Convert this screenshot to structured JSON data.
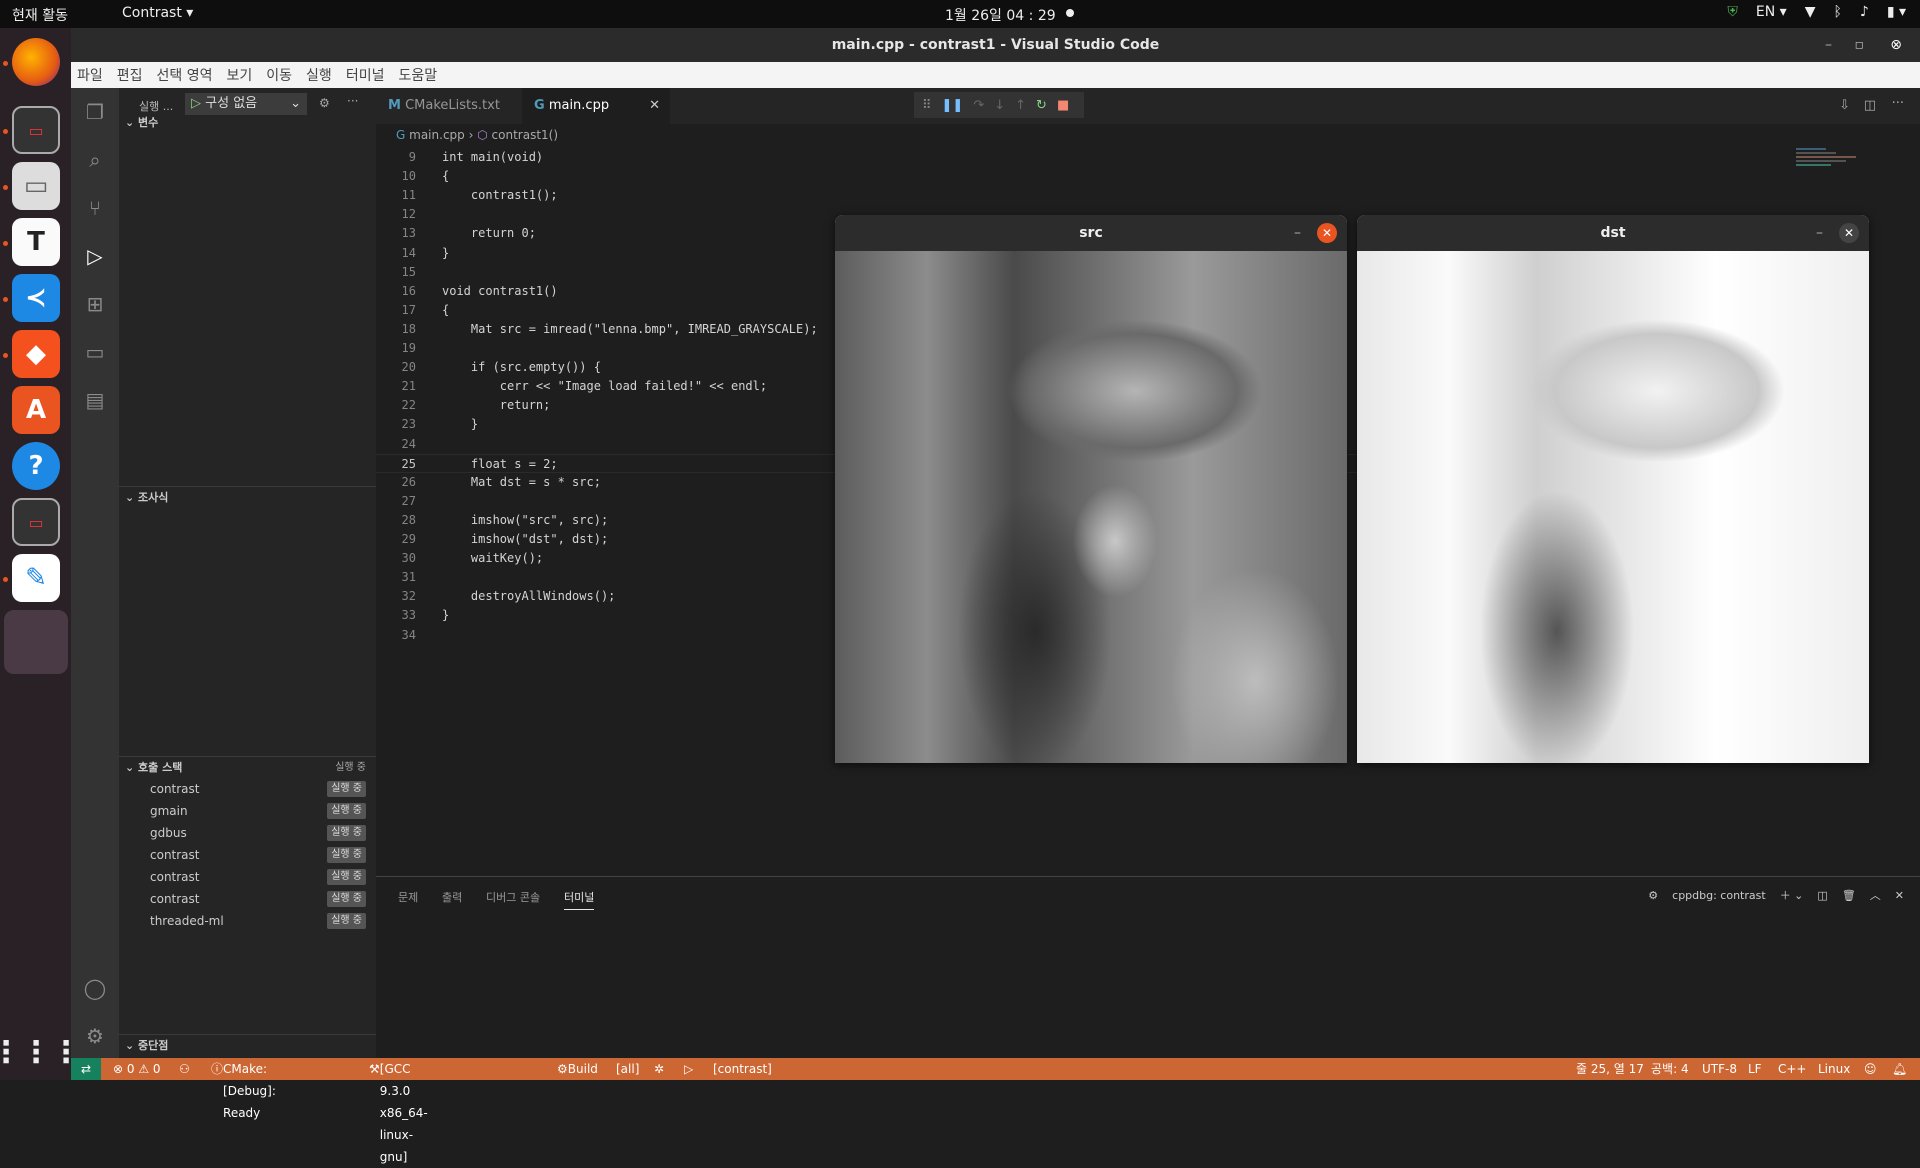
{
  "topbar": {
    "activities": "현재 활동",
    "app_name": "Contrast ▾",
    "clock": "1월 26일  04 : 29",
    "lang": "EN ▾"
  },
  "window": {
    "title": "main.cpp - contrast1 - Visual Studio Code"
  },
  "menu": [
    "파일",
    "편집",
    "선택 영역",
    "보기",
    "이동",
    "실행",
    "터미널",
    "도움말"
  ],
  "run_view": {
    "run_label": "실행 ...",
    "config": "구성 없음",
    "variables_header": "변수",
    "watch_header": "조사식",
    "callstack_header": "호출 스택",
    "callstack_status": "실행 중",
    "callstack": [
      {
        "name": "contrast",
        "state": "실행 중"
      },
      {
        "name": "gmain",
        "state": "실행 중"
      },
      {
        "name": "gdbus",
        "state": "실행 중"
      },
      {
        "name": "contrast",
        "state": "실행 중"
      },
      {
        "name": "contrast",
        "state": "실행 중"
      },
      {
        "name": "contrast",
        "state": "실행 중"
      },
      {
        "name": "threaded-ml",
        "state": "실행 중"
      }
    ],
    "breakpoints_header": "중단점"
  },
  "tabs": [
    {
      "label": "CMakeLists.txt",
      "icon": "M",
      "active": false
    },
    {
      "label": "main.cpp",
      "icon": "G",
      "active": true
    }
  ],
  "breadcrumb": {
    "file": "main.cpp",
    "symbol": "contrast1()"
  },
  "code": [
    {
      "n": "9",
      "t": "int main(void)"
    },
    {
      "n": "10",
      "t": "{"
    },
    {
      "n": "11",
      "t": "    contrast1();"
    },
    {
      "n": "12",
      "t": ""
    },
    {
      "n": "13",
      "t": "    return 0;"
    },
    {
      "n": "14",
      "t": "}"
    },
    {
      "n": "15",
      "t": ""
    },
    {
      "n": "16",
      "t": "void contrast1()"
    },
    {
      "n": "17",
      "t": "{"
    },
    {
      "n": "18",
      "t": "    Mat src = imread(\"lenna.bmp\", IMREAD_GRAYSCALE);"
    },
    {
      "n": "19",
      "t": ""
    },
    {
      "n": "20",
      "t": "    if (src.empty()) {"
    },
    {
      "n": "21",
      "t": "        cerr << \"Image load failed!\" << endl;"
    },
    {
      "n": "22",
      "t": "        return;"
    },
    {
      "n": "23",
      "t": "    }"
    },
    {
      "n": "24",
      "t": ""
    },
    {
      "n": "25",
      "t": "    float s = 2;"
    },
    {
      "n": "26",
      "t": "    Mat dst = s * src;"
    },
    {
      "n": "27",
      "t": ""
    },
    {
      "n": "28",
      "t": "    imshow(\"src\", src);"
    },
    {
      "n": "29",
      "t": "    imshow(\"dst\", dst);"
    },
    {
      "n": "30",
      "t": "    waitKey();"
    },
    {
      "n": "31",
      "t": ""
    },
    {
      "n": "32",
      "t": "    destroyAllWindows();"
    },
    {
      "n": "33",
      "t": "}"
    },
    {
      "n": "34",
      "t": ""
    }
  ],
  "active_line": "25",
  "image_windows": [
    {
      "title": "src"
    },
    {
      "title": "dst"
    }
  ],
  "panel": {
    "tabs": [
      "문제",
      "출력",
      "디버그 콘솔",
      "터미널"
    ],
    "active_tab": "터미널",
    "terminal_name": "cppdbg: contrast"
  },
  "status": {
    "errors": "⊗ 0 ⚠ 0",
    "cmake": "CMake: [Debug]: Ready",
    "kit": "[GCC 9.3.0 x86_64-linux-gnu]",
    "build": "Build",
    "target": "[all]",
    "launch": "[contrast]",
    "position": "줄 25, 열 17",
    "spaces": "공백: 4",
    "encoding": "UTF-8",
    "eol": "LF",
    "language": "C++",
    "platform": "Linux"
  },
  "colors": {
    "statusbar": "#cc6633",
    "ubuntu_orange": "#e95420"
  }
}
